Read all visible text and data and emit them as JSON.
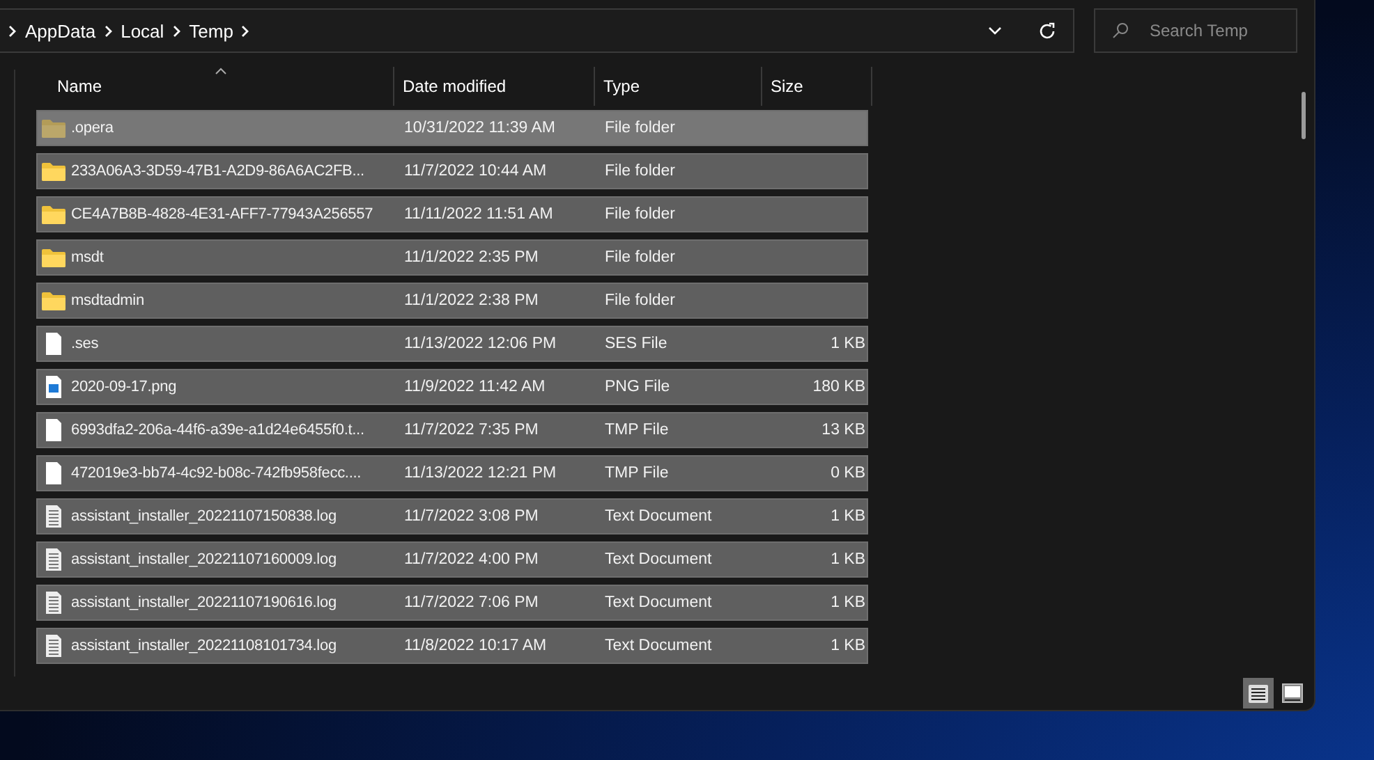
{
  "address_bar": {
    "path": [
      "AppData",
      "Local",
      "Temp"
    ]
  },
  "search": {
    "placeholder": "Search Temp"
  },
  "table": {
    "columns": [
      {
        "label": "Name",
        "sorted": true
      },
      {
        "label": "Date modified",
        "sorted": false
      },
      {
        "label": "Type",
        "sorted": false
      },
      {
        "label": "Size",
        "sorted": false
      }
    ],
    "rows": [
      {
        "kind": "folder",
        "hidden": true,
        "hovered": true,
        "selected": true,
        "name": ".opera",
        "date": "10/31/2022 11:39 AM",
        "type": "File folder"
      },
      {
        "kind": "folder",
        "hidden": false,
        "hovered": false,
        "selected": true,
        "name": "233A06A3-3D59-47B1-A2D9-86A6AC2FB...",
        "date": "11/7/2022 10:44 AM",
        "type": "File folder"
      },
      {
        "kind": "folder",
        "hidden": false,
        "hovered": false,
        "selected": true,
        "name": "CE4A7B8B-4828-4E31-AFF7-77943A256557",
        "date": "11/11/2022 11:51 AM",
        "type": "File folder"
      },
      {
        "kind": "folder",
        "hidden": false,
        "hovered": false,
        "selected": true,
        "name": "msdt",
        "date": "11/1/2022 2:35 PM",
        "type": "File folder"
      },
      {
        "kind": "folder",
        "hidden": false,
        "hovered": false,
        "selected": true,
        "name": "msdtadmin",
        "date": "11/1/2022 2:38 PM",
        "type": "File folder"
      },
      {
        "kind": "file",
        "hidden": false,
        "hovered": false,
        "selected": true,
        "name": ".ses",
        "date": "11/13/2022 12:06 PM",
        "type": "SES File",
        "size": "1 KB"
      },
      {
        "kind": "image",
        "hidden": false,
        "hovered": false,
        "selected": true,
        "name": "2020-09-17.png",
        "date": "11/9/2022 11:42 AM",
        "type": "PNG File",
        "size": "180 KB"
      },
      {
        "kind": "file",
        "hidden": false,
        "hovered": false,
        "selected": true,
        "name": "6993dfa2-206a-44f6-a39e-a1d24e6455f0.t...",
        "date": "11/7/2022 7:35 PM",
        "type": "TMP File",
        "size": "13 KB"
      },
      {
        "kind": "file",
        "hidden": false,
        "hovered": false,
        "selected": true,
        "name": "472019e3-bb74-4c92-b08c-742fb958fecc....",
        "date": "11/13/2022 12:21 PM",
        "type": "TMP File",
        "size": "0 KB"
      },
      {
        "kind": "text",
        "hidden": false,
        "hovered": false,
        "selected": true,
        "name": "assistant_installer_20221107150838.log",
        "date": "11/7/2022 3:08 PM",
        "type": "Text Document",
        "size": "1 KB"
      },
      {
        "kind": "text",
        "hidden": false,
        "hovered": false,
        "selected": true,
        "name": "assistant_installer_20221107160009.log",
        "date": "11/7/2022 4:00 PM",
        "type": "Text Document",
        "size": "1 KB"
      },
      {
        "kind": "text",
        "hidden": false,
        "hovered": false,
        "selected": true,
        "name": "assistant_installer_20221107190616.log",
        "date": "11/7/2022 7:06 PM",
        "type": "Text Document",
        "size": "1 KB"
      },
      {
        "kind": "text",
        "hidden": false,
        "hovered": false,
        "selected": true,
        "name": "assistant_installer_20221108101734.log",
        "date": "11/8/2022 10:17 AM",
        "type": "Text Document",
        "size": "1 KB"
      }
    ]
  },
  "status_bar": {
    "views": [
      {
        "kind": "details",
        "selected": true
      },
      {
        "kind": "preview",
        "selected": false
      }
    ]
  }
}
